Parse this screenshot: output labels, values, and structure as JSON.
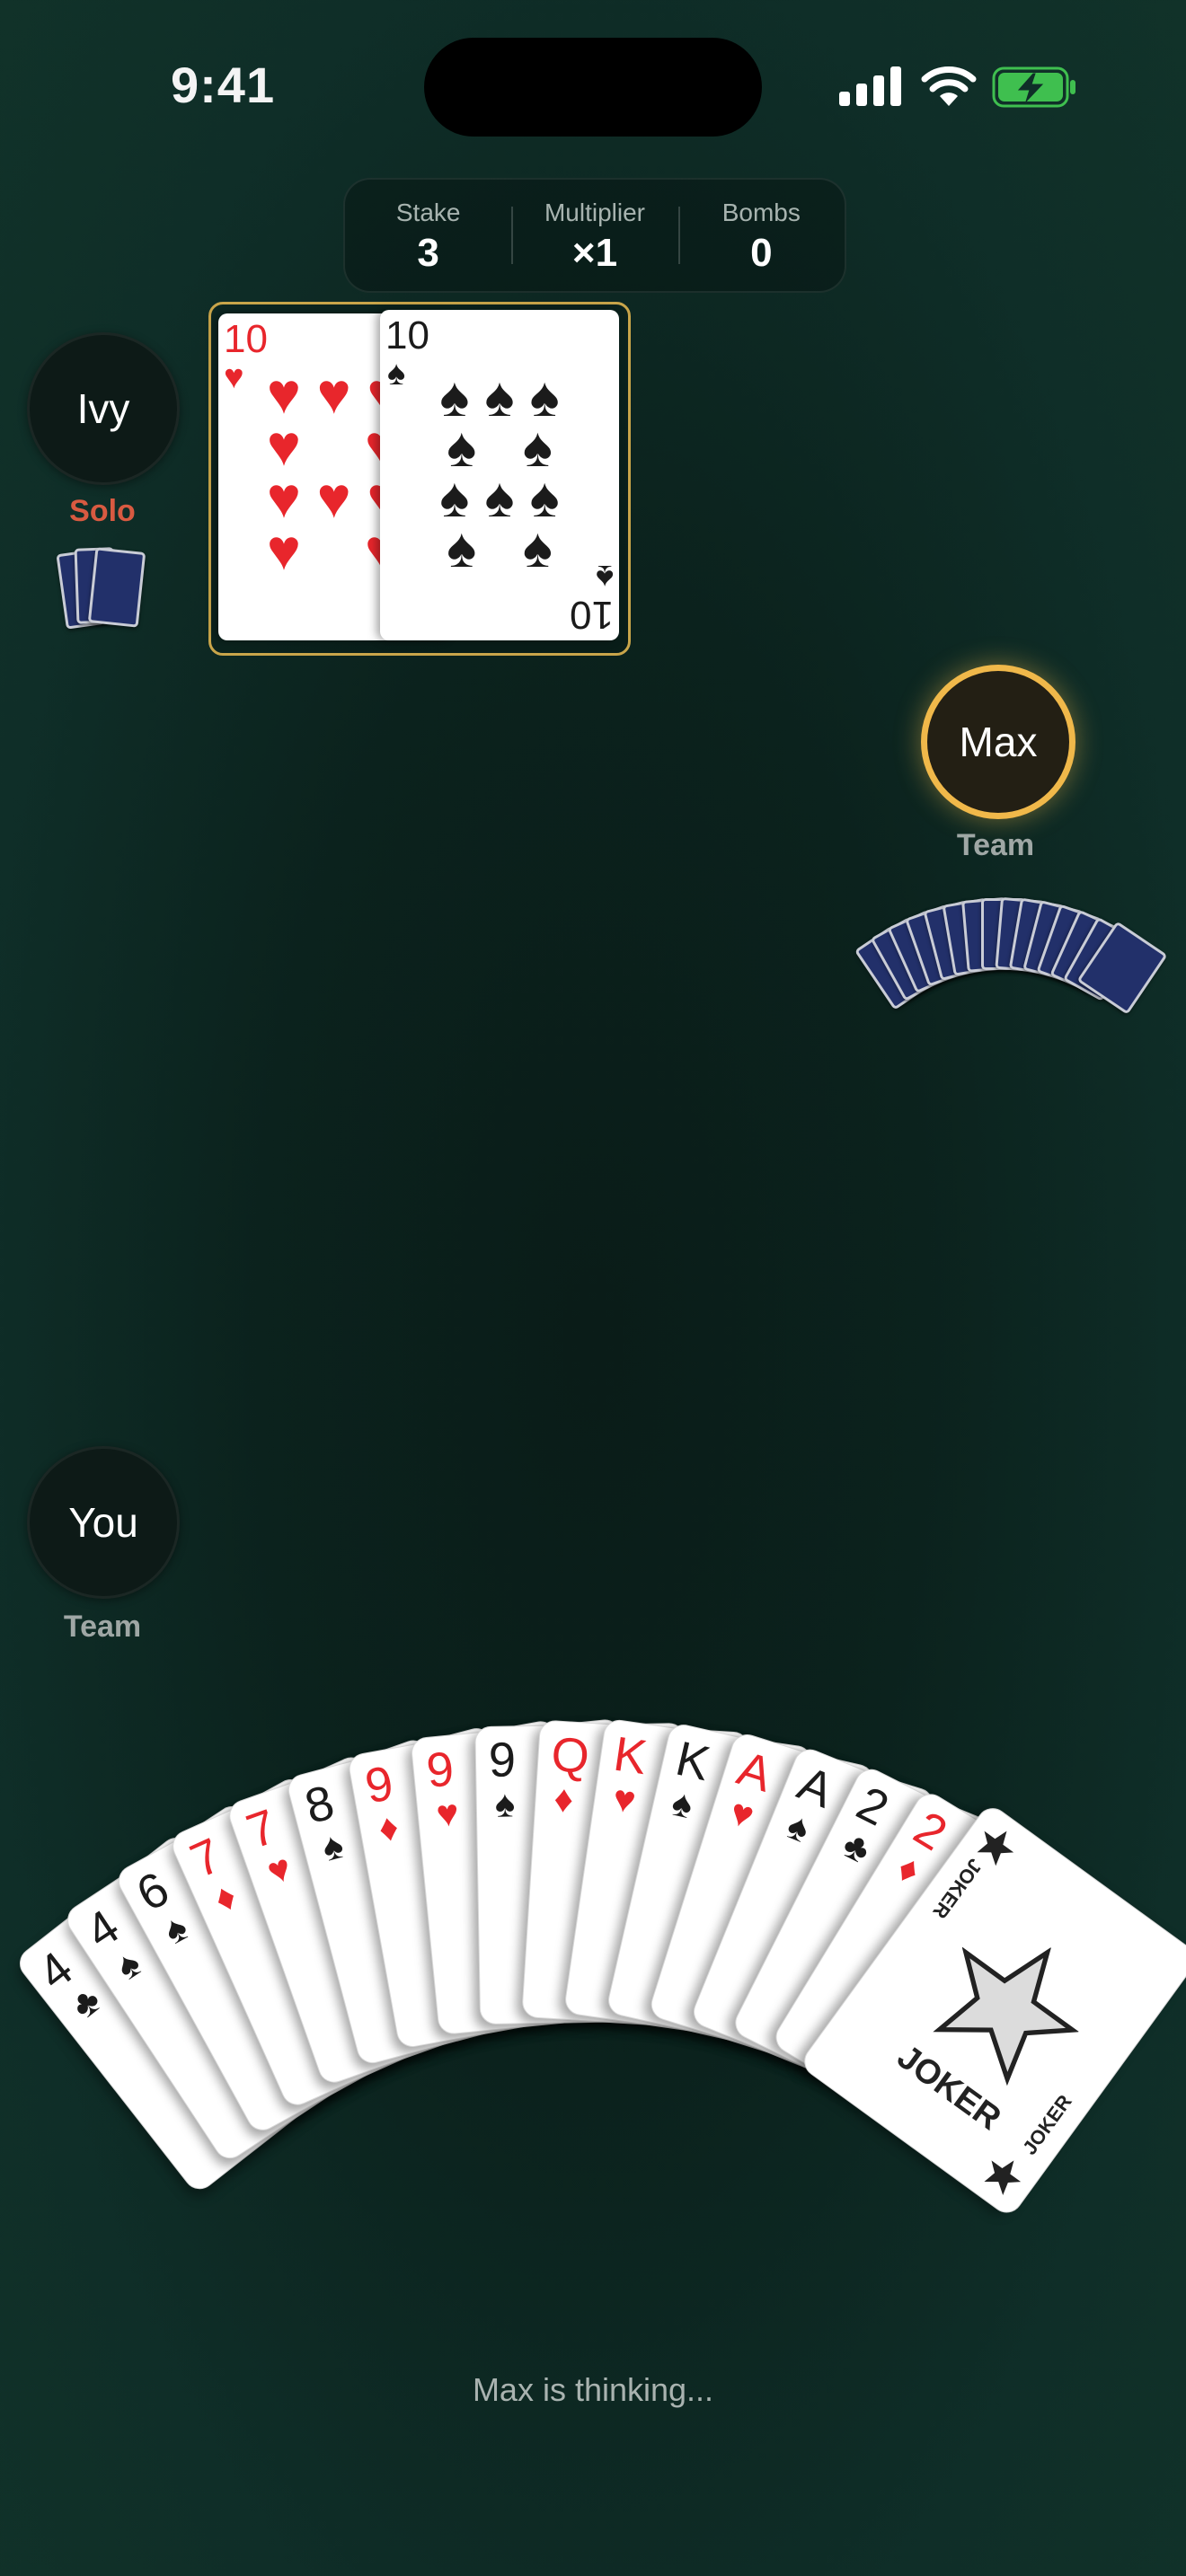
{
  "status_bar": {
    "time": "9:41"
  },
  "score": {
    "stake_label": "Stake",
    "stake_value": "3",
    "multiplier_label": "Multiplier",
    "multiplier_value": "×1",
    "bombs_label": "Bombs",
    "bombs_value": "0"
  },
  "players": {
    "left": {
      "name": "Ivy",
      "role": "Solo"
    },
    "right": {
      "name": "Max",
      "role": "Team"
    },
    "self": {
      "name": "You",
      "role": "Team"
    }
  },
  "played_cards": [
    {
      "rank": "10",
      "suit": "♥",
      "color": "#e8262c"
    },
    {
      "rank": "10",
      "suit": "♠",
      "color": "#1b1b1b"
    }
  ],
  "hand": [
    {
      "rank": "4",
      "suit": "♣",
      "color": "#1b1b1b"
    },
    {
      "rank": "4",
      "suit": "♠",
      "color": "#1b1b1b"
    },
    {
      "rank": "6",
      "suit": "♠",
      "color": "#1b1b1b"
    },
    {
      "rank": "7",
      "suit": "♦",
      "color": "#e8262c"
    },
    {
      "rank": "7",
      "suit": "♥",
      "color": "#e8262c"
    },
    {
      "rank": "8",
      "suit": "♠",
      "color": "#1b1b1b"
    },
    {
      "rank": "9",
      "suit": "♦",
      "color": "#e8262c"
    },
    {
      "rank": "9",
      "suit": "♥",
      "color": "#e8262c"
    },
    {
      "rank": "9",
      "suit": "♠",
      "color": "#1b1b1b"
    },
    {
      "rank": "Q",
      "suit": "♦",
      "color": "#e8262c"
    },
    {
      "rank": "K",
      "suit": "♥",
      "color": "#e8262c"
    },
    {
      "rank": "K",
      "suit": "♠",
      "color": "#1b1b1b"
    },
    {
      "rank": "A",
      "suit": "♥",
      "color": "#e8262c"
    },
    {
      "rank": "A",
      "suit": "♠",
      "color": "#1b1b1b"
    },
    {
      "rank": "2",
      "suit": "♣",
      "color": "#1b1b1b"
    },
    {
      "rank": "2",
      "suit": "♦",
      "color": "#e8262c"
    }
  ],
  "joker": {
    "label": "JOKER",
    "small_label": "JOKER"
  },
  "status_text": "Max is thinking...",
  "colors": {
    "active_ring": "#f0b84a",
    "solo": "#d85a41",
    "frame": "#c9a54a",
    "card_back": "#22306a"
  }
}
